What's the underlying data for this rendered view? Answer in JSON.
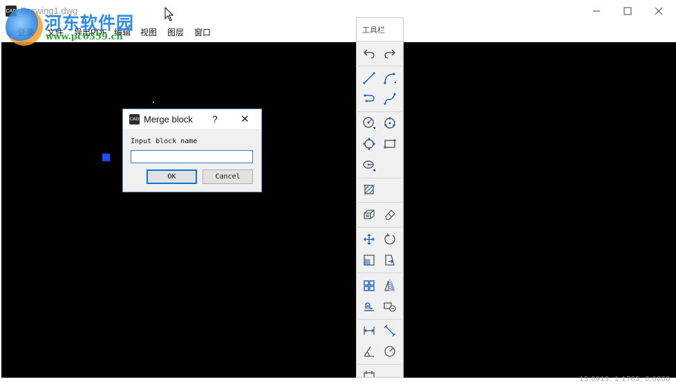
{
  "window": {
    "title": "Drawing1.dwg",
    "logo_text": "CAD",
    "controls": {
      "minimize": "—",
      "maximize": "☐",
      "close": "✕"
    }
  },
  "menu": {
    "items": [
      "登录",
      "文件",
      "导出PDF",
      "编辑",
      "视图",
      "图层",
      "窗口"
    ]
  },
  "watermark": {
    "text": "河东软件园",
    "url": "www.pc0359.cn"
  },
  "dialog": {
    "title": "Merge block",
    "help": "?",
    "close": "✕",
    "logo_text": "CAD",
    "label": "Input block name",
    "input_value": "",
    "ok_label": "OK",
    "cancel_label": "Cancel"
  },
  "toolbar": {
    "title": "工具栏",
    "tools": [
      "undo-icon",
      "redo-icon",
      "line-icon",
      "arc-line-icon",
      "polyline-icon",
      "spline-icon",
      "circle-icon",
      "circle-3pt-icon",
      "circle-tangent-icon",
      "rectangle-icon",
      "ellipse-icon",
      "hatch-icon",
      "block-icon",
      "eraser-icon",
      "move-icon",
      "rotate-icon",
      "scale-icon",
      "stretch-icon",
      "array-icon",
      "mirror-icon",
      "offset-icon",
      "insert-block-icon",
      "dim-linear-icon",
      "dim-aligned-icon",
      "dim-angle-icon",
      "dim-radius-icon",
      "more-tools-icon"
    ]
  },
  "status": {
    "coords": "15.0913, 1.1763, 0.0000"
  },
  "colors": {
    "canvas": "#000000",
    "grip": "#1f4cff",
    "accent": "#3a78c9"
  }
}
